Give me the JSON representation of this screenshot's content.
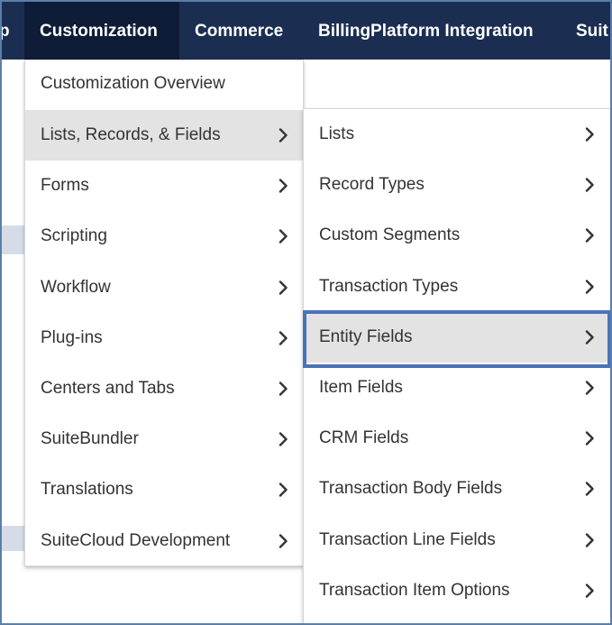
{
  "navbar": {
    "items": [
      {
        "label": "p"
      },
      {
        "label": "Customization"
      },
      {
        "label": "Commerce"
      },
      {
        "label": "BillingPlatform Integration"
      },
      {
        "label": "Suit"
      }
    ]
  },
  "menu_primary": {
    "overview_label": "Customization Overview",
    "items": [
      {
        "label": "Lists, Records, & Fields"
      },
      {
        "label": "Forms"
      },
      {
        "label": "Scripting"
      },
      {
        "label": "Workflow"
      },
      {
        "label": "Plug-ins"
      },
      {
        "label": "Centers and Tabs"
      },
      {
        "label": "SuiteBundler"
      },
      {
        "label": "Translations"
      },
      {
        "label": "SuiteCloud Development"
      }
    ]
  },
  "menu_submenu": {
    "items": [
      {
        "label": "Lists"
      },
      {
        "label": "Record Types"
      },
      {
        "label": "Custom Segments"
      },
      {
        "label": "Transaction Types"
      },
      {
        "label": "Entity Fields"
      },
      {
        "label": "Item Fields"
      },
      {
        "label": "CRM Fields"
      },
      {
        "label": "Transaction Body Fields"
      },
      {
        "label": "Transaction Line Fields"
      },
      {
        "label": "Transaction Item Options"
      }
    ]
  },
  "colors": {
    "navbar_bg": "#1b2e52",
    "navbar_active_bg": "#0e1c38",
    "hover_bg": "#e3e3e3",
    "highlight_border": "#4a72b8"
  }
}
